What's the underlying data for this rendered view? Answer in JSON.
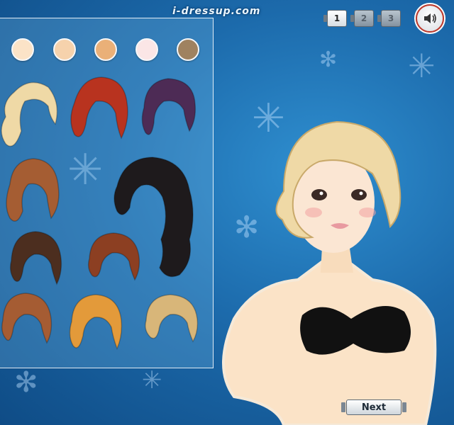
{
  "header": {
    "site_logo": "i-dressup.com",
    "pages": [
      {
        "label": "1",
        "active": true
      },
      {
        "label": "2",
        "active": false
      },
      {
        "label": "3",
        "active": false
      }
    ],
    "sound_icon": "speaker-icon"
  },
  "skin_tones": {
    "swatches": [
      "#fbe3c7",
      "#f6d2ac",
      "#eab078",
      "#fbe6e6",
      "#9f8260"
    ]
  },
  "hair_options": {
    "colors": [
      "#efd9a6",
      "#b8331f",
      "#4d2b55",
      "#a55d33",
      "#1e1a1c",
      "#4c2e1f",
      "#8c3f22",
      "#a55c33",
      "#e39a3a",
      "#d8b679"
    ]
  },
  "controls": {
    "next_label": "Next"
  }
}
